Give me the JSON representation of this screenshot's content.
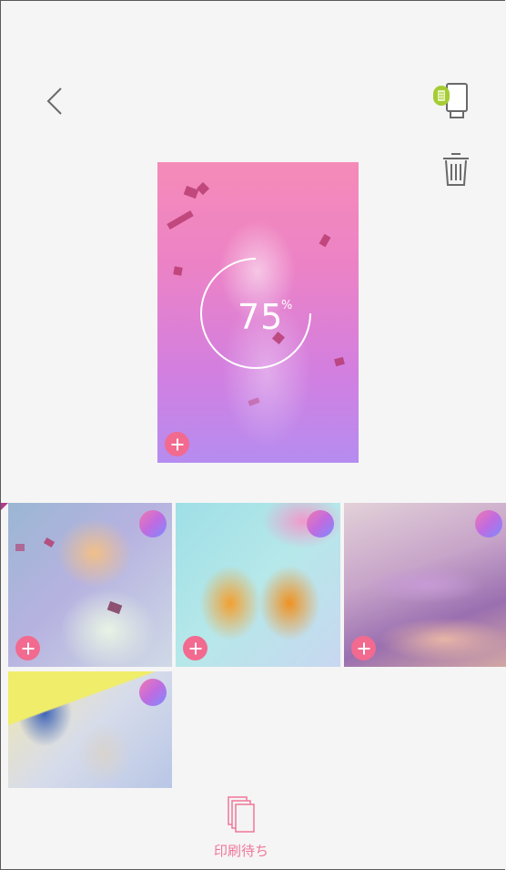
{
  "toolbar": {
    "back_icon": "chevron-left-icon",
    "printer_icon": "printer-status-icon",
    "trash_icon": "trash-icon"
  },
  "preview": {
    "progress": 75,
    "progress_value": "75",
    "progress_unit": "%"
  },
  "thumbnails": [
    {
      "name": "thumbnail-woman-confetti"
    },
    {
      "name": "thumbnail-mason-jar-drinks"
    },
    {
      "name": "thumbnail-glitter"
    },
    {
      "name": "thumbnail-letters"
    }
  ],
  "footer": {
    "queue_label": "印刷待ち",
    "queue_icon": "print-queue-icon"
  },
  "colors": {
    "accent": "#f26a8f",
    "printer_indicator": "#8bc34a",
    "label_pink": "#f0779a"
  }
}
